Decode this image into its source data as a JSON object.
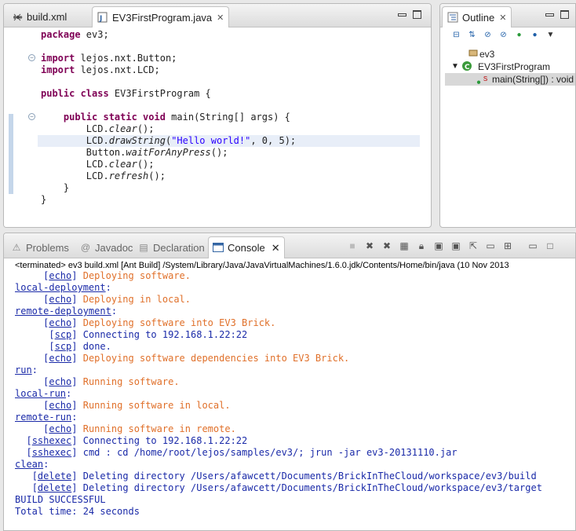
{
  "editor": {
    "tabs": [
      {
        "label": "build.xml",
        "active": false
      },
      {
        "label": "EV3FirstProgram.java",
        "active": true
      }
    ],
    "code": {
      "package_kw": "package",
      "package_name": " ev3;",
      "import_kw": "import",
      "import1": " lejos.nxt.Button;",
      "import2": " lejos.nxt.LCD;",
      "class_kw": "public class",
      "class_name": " EV3FirstProgram {",
      "main_kw": "public static void",
      "main_sig": " main(String[] args) {",
      "lcd": "LCD.",
      "clear": "clear",
      "call_end": "();",
      "drawString": "drawString",
      "draw_open": "(",
      "draw_str": "\"Hello world!\"",
      "draw_rest": ", 0, 5);",
      "button": "Button.",
      "wait": "waitForAnyPress",
      "refresh": "refresh",
      "close_inner": "}",
      "close_outer": "}"
    }
  },
  "outline": {
    "tab_label": "Outline",
    "items": [
      {
        "label": "ev3"
      },
      {
        "label": "EV3FirstProgram"
      },
      {
        "label": "main(String[]) : void"
      }
    ]
  },
  "console": {
    "tabs": [
      "Problems",
      "Javadoc",
      "Declaration",
      "Console"
    ],
    "status": "<terminated> ev3 build.xml [Ant Build] /System/Library/Java/JavaVirtualMachines/1.6.0.jdk/Contents/Home/bin/java (10 Nov 2013",
    "lines": [
      {
        "indent": "     ",
        "task": "echo",
        "text": " Deploying software.",
        "color": "orange"
      },
      {
        "target": "local-deployment",
        "text": ":"
      },
      {
        "indent": "     ",
        "task": "echo",
        "text": " Deploying in local.",
        "color": "orange"
      },
      {
        "target": "remote-deployment",
        "text": ":"
      },
      {
        "indent": "     ",
        "task": "echo",
        "text": " Deploying software into EV3 Brick.",
        "color": "orange"
      },
      {
        "indent": "      ",
        "task": "scp",
        "text": " Connecting to 192.168.1.22:22",
        "color": "blue"
      },
      {
        "indent": "      ",
        "task": "scp",
        "text": " done.",
        "color": "blue"
      },
      {
        "indent": "     ",
        "task": "echo",
        "text": " Deploying software dependencies into EV3 Brick.",
        "color": "orange"
      },
      {
        "target": "run",
        "text": ":"
      },
      {
        "indent": "     ",
        "task": "echo",
        "text": " Running software.",
        "color": "orange"
      },
      {
        "target": "local-run",
        "text": ":"
      },
      {
        "indent": "     ",
        "task": "echo",
        "text": " Running software in local.",
        "color": "orange"
      },
      {
        "target": "remote-run",
        "text": ":"
      },
      {
        "indent": "     ",
        "task": "echo",
        "text": " Running software in remote.",
        "color": "orange"
      },
      {
        "indent": "  ",
        "task": "sshexec",
        "text": " Connecting to 192.168.1.22:22",
        "color": "blue"
      },
      {
        "indent": "  ",
        "task": "sshexec",
        "text": " cmd : cd /home/root/lejos/samples/ev3/; jrun -jar ev3-20131110.jar",
        "color": "blue"
      },
      {
        "target": "clean",
        "text": ":"
      },
      {
        "indent": "   ",
        "task": "delete",
        "text": " Deleting directory /Users/afawcett/Documents/BrickInTheCloud/workspace/ev3/build",
        "color": "blue"
      },
      {
        "indent": "   ",
        "task": "delete",
        "text": " Deleting directory /Users/afawcett/Documents/BrickInTheCloud/workspace/ev3/target",
        "color": "blue"
      },
      {
        "plain": "BUILD SUCCESSFUL",
        "color": "blue"
      },
      {
        "plain": "Total time: 24 seconds",
        "color": "blue"
      }
    ]
  },
  "colors": {
    "keyword": "#7f0055",
    "string": "#2a00ff",
    "echo_output": "#e0702a",
    "console_blue": "#1a2aa8"
  }
}
